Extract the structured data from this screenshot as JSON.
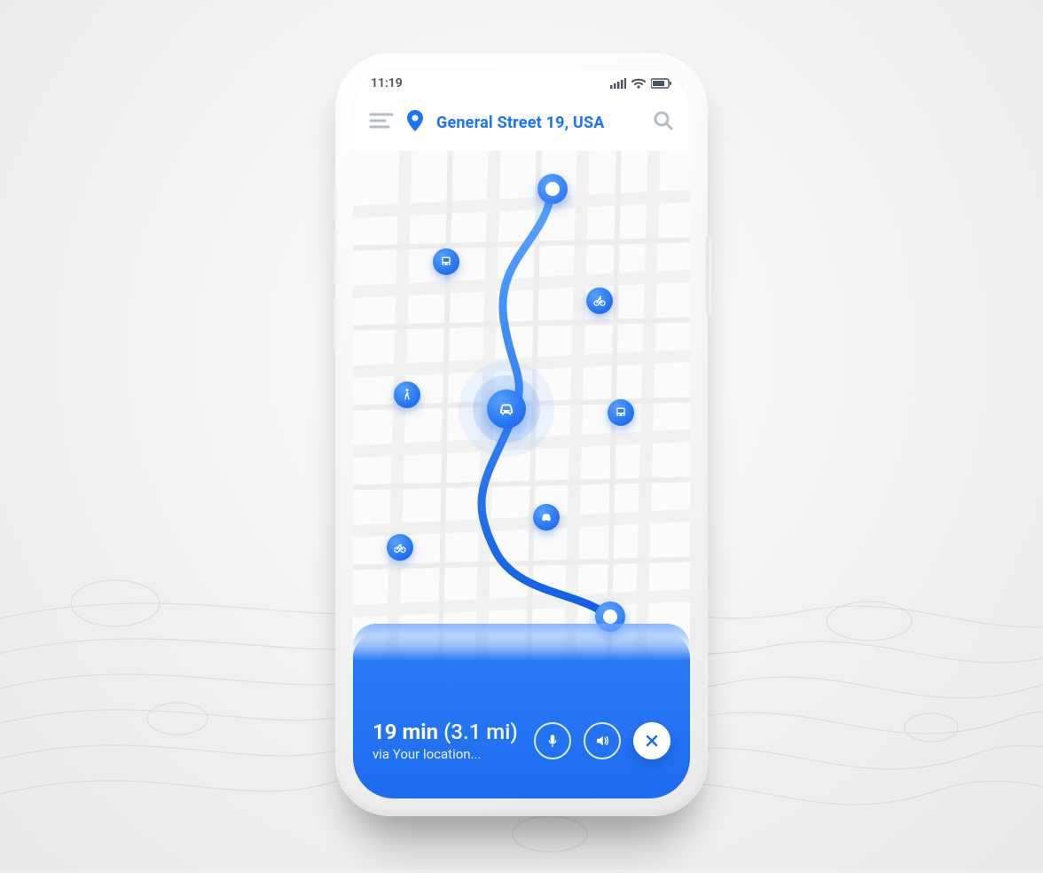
{
  "statusbar": {
    "time": "11:19"
  },
  "header": {
    "address": "General Street 19, USA"
  },
  "pois": [
    {
      "name": "bus-poi",
      "type": "bus"
    },
    {
      "name": "bike-poi-top",
      "type": "bike"
    },
    {
      "name": "walk-poi",
      "type": "walk"
    },
    {
      "name": "car-current-poi",
      "type": "car"
    },
    {
      "name": "bus-poi-right",
      "type": "bus"
    },
    {
      "name": "car-poi-small",
      "type": "car"
    },
    {
      "name": "bike-poi-bottom",
      "type": "bike"
    }
  ],
  "route": {
    "eta_value": "19",
    "eta_unit": "min",
    "distance": "(3.1 mi)",
    "via": "via Your location..."
  },
  "colors": {
    "accent": "#1d6cf0"
  }
}
